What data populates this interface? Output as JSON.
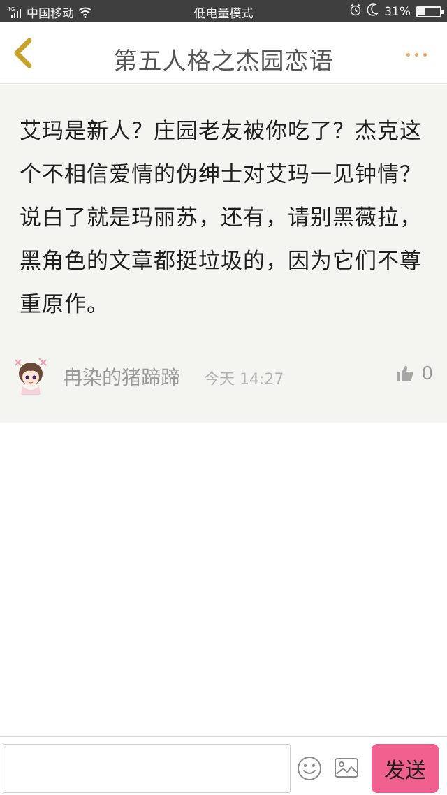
{
  "status_bar": {
    "network": "4G",
    "carrier": "中国移动",
    "mode": "低电量模式",
    "battery": "31%",
    "battery_level": 0.31,
    "icons": [
      "signal-icon",
      "wifi-icon",
      "alarm-icon",
      "moon-icon",
      "battery-icon"
    ]
  },
  "header": {
    "title": "第五人格之杰园恋语",
    "back_icon": "chevron-left-icon",
    "more_icon": "more-dots-icon",
    "accent_color": "#c8a12a"
  },
  "comment": {
    "text": "艾玛是新人？庄园老友被你吃了？杰克这个不相信爱情的伪绅士对艾玛一见钟情？说白了就是玛丽苏，还有，请别黑薇拉，黑角色的文章都挺垃圾的，因为它们不尊重原作。",
    "author": "冉染的猪蹄蹄",
    "time": "今天 14:27",
    "likes": "0",
    "like_icon": "thumbs-up-icon"
  },
  "input_bar": {
    "value": "",
    "placeholder": "",
    "emoji_icon": "smiley-icon",
    "image_icon": "image-icon",
    "send_label": "发送",
    "send_color": "#f2608f"
  }
}
